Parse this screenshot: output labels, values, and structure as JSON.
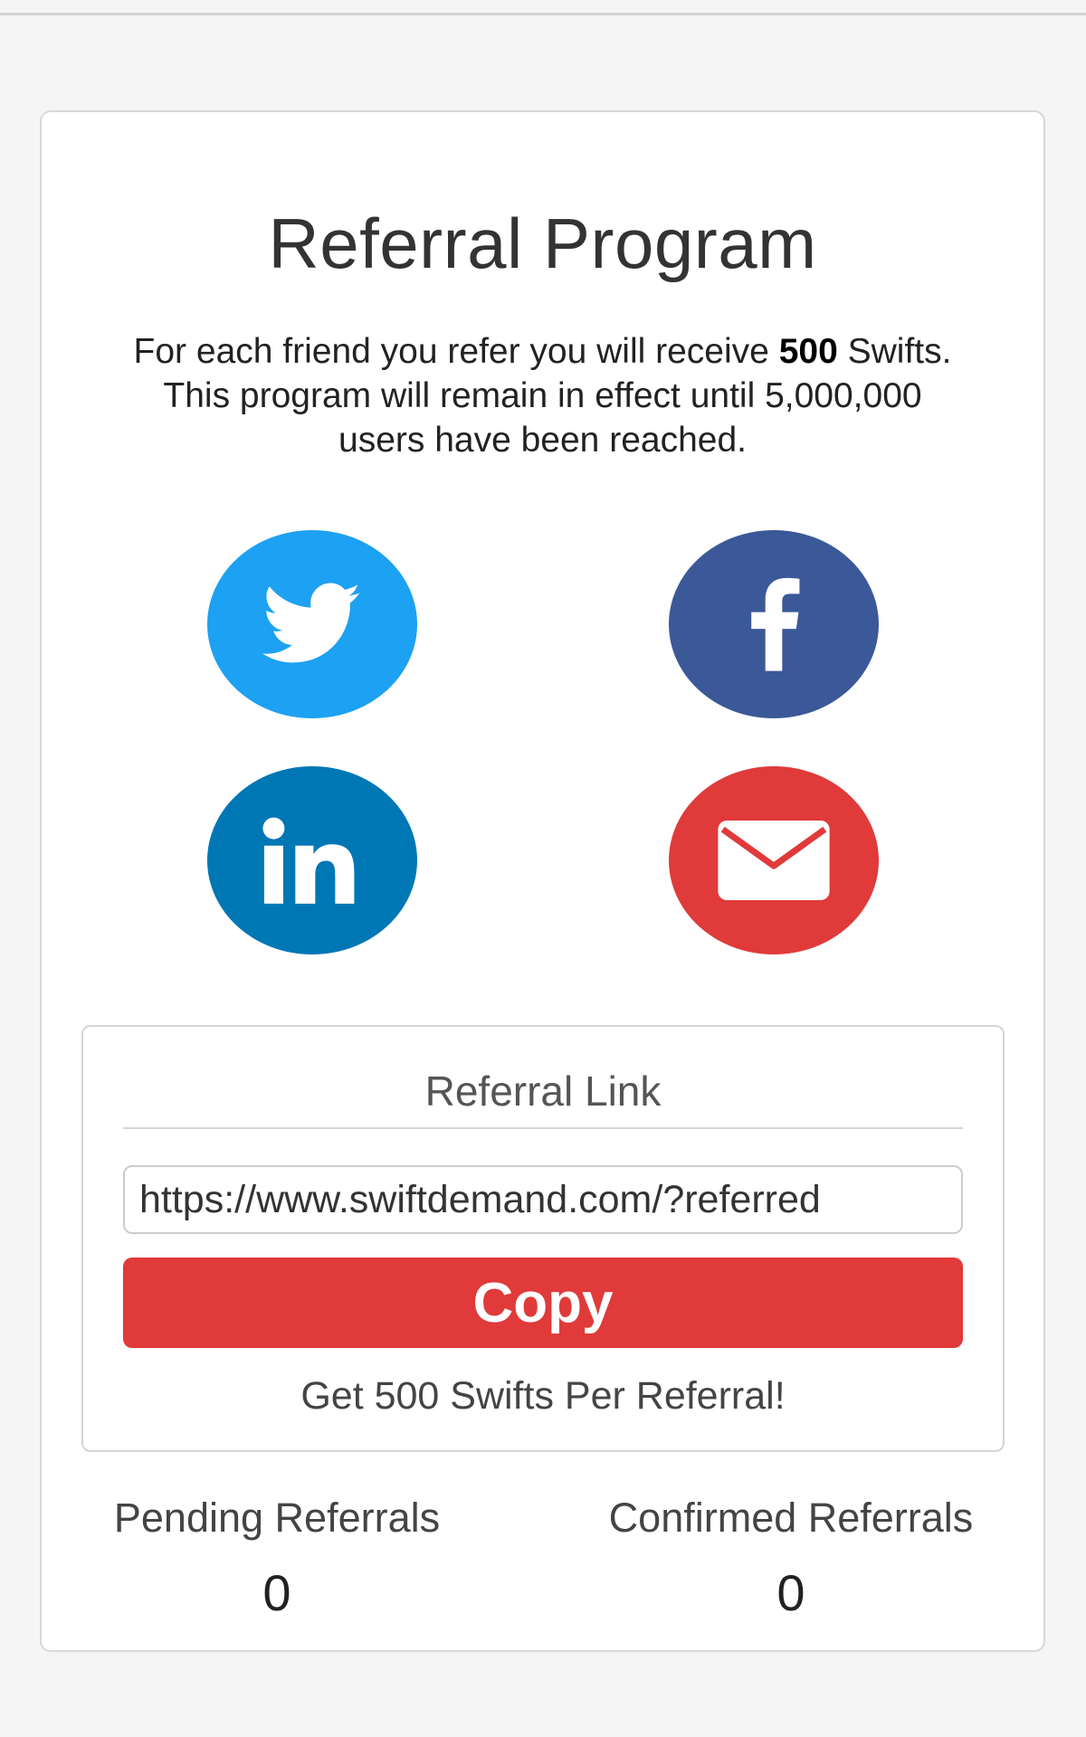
{
  "page": {
    "title": "Referral Program",
    "description_prefix": "For each friend you refer you will receive ",
    "description_bold": "500",
    "description_suffix": " Swifts. This program will remain in effect until 5,000,000 users have been reached."
  },
  "share": {
    "buttons": [
      {
        "name": "twitter",
        "icon": "twitter-icon",
        "color": "#1da1f2"
      },
      {
        "name": "facebook",
        "icon": "facebook-icon",
        "color": "#3b5998"
      },
      {
        "name": "linkedin",
        "icon": "linkedin-icon",
        "color": "#0077b5"
      },
      {
        "name": "email",
        "icon": "mail-icon",
        "color": "#e03a3a"
      }
    ]
  },
  "referral_link": {
    "title": "Referral Link",
    "url": "https://www.swiftdemand.com/?referred",
    "copy_label": "Copy",
    "per_referral_text": "Get 500 Swifts Per Referral!"
  },
  "stats": {
    "pending_label": "Pending Referrals",
    "pending_value": "0",
    "confirmed_label": "Confirmed Referrals",
    "confirmed_value": "0"
  },
  "colors": {
    "accent": "#e03a3a",
    "card_bg": "#ffffff",
    "page_bg": "#f5f5f5"
  }
}
